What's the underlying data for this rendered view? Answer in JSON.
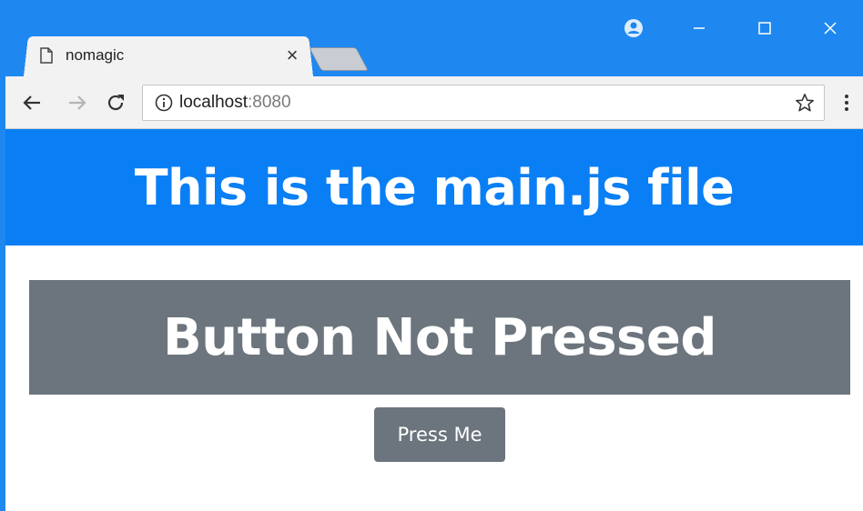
{
  "browser": {
    "tab": {
      "title": "nomagic",
      "close_glyph": "×"
    },
    "address_bar": {
      "host": "localhost",
      "port": ":8080"
    },
    "icons": {
      "tab_page": "page-icon",
      "back": "back-arrow-icon",
      "forward": "forward-arrow-icon",
      "reload": "reload-icon",
      "info": "info-icon",
      "bookmark": "star-icon",
      "menu": "kebab-menu-icon",
      "profile": "profile-icon",
      "minimize": "minimize-icon",
      "maximize": "maximize-icon",
      "close": "close-icon"
    },
    "colors": {
      "chrome_blue": "#1e88f0",
      "toolbar_bg": "#f2f2f2"
    }
  },
  "page": {
    "header": {
      "text": "This is the main.js file",
      "bg_color": "#0a7ff5"
    },
    "status": {
      "text": "Button Not Pressed",
      "bg_color": "#6c757d"
    },
    "button": {
      "label": "Press Me",
      "bg_color": "#6c757d"
    }
  }
}
